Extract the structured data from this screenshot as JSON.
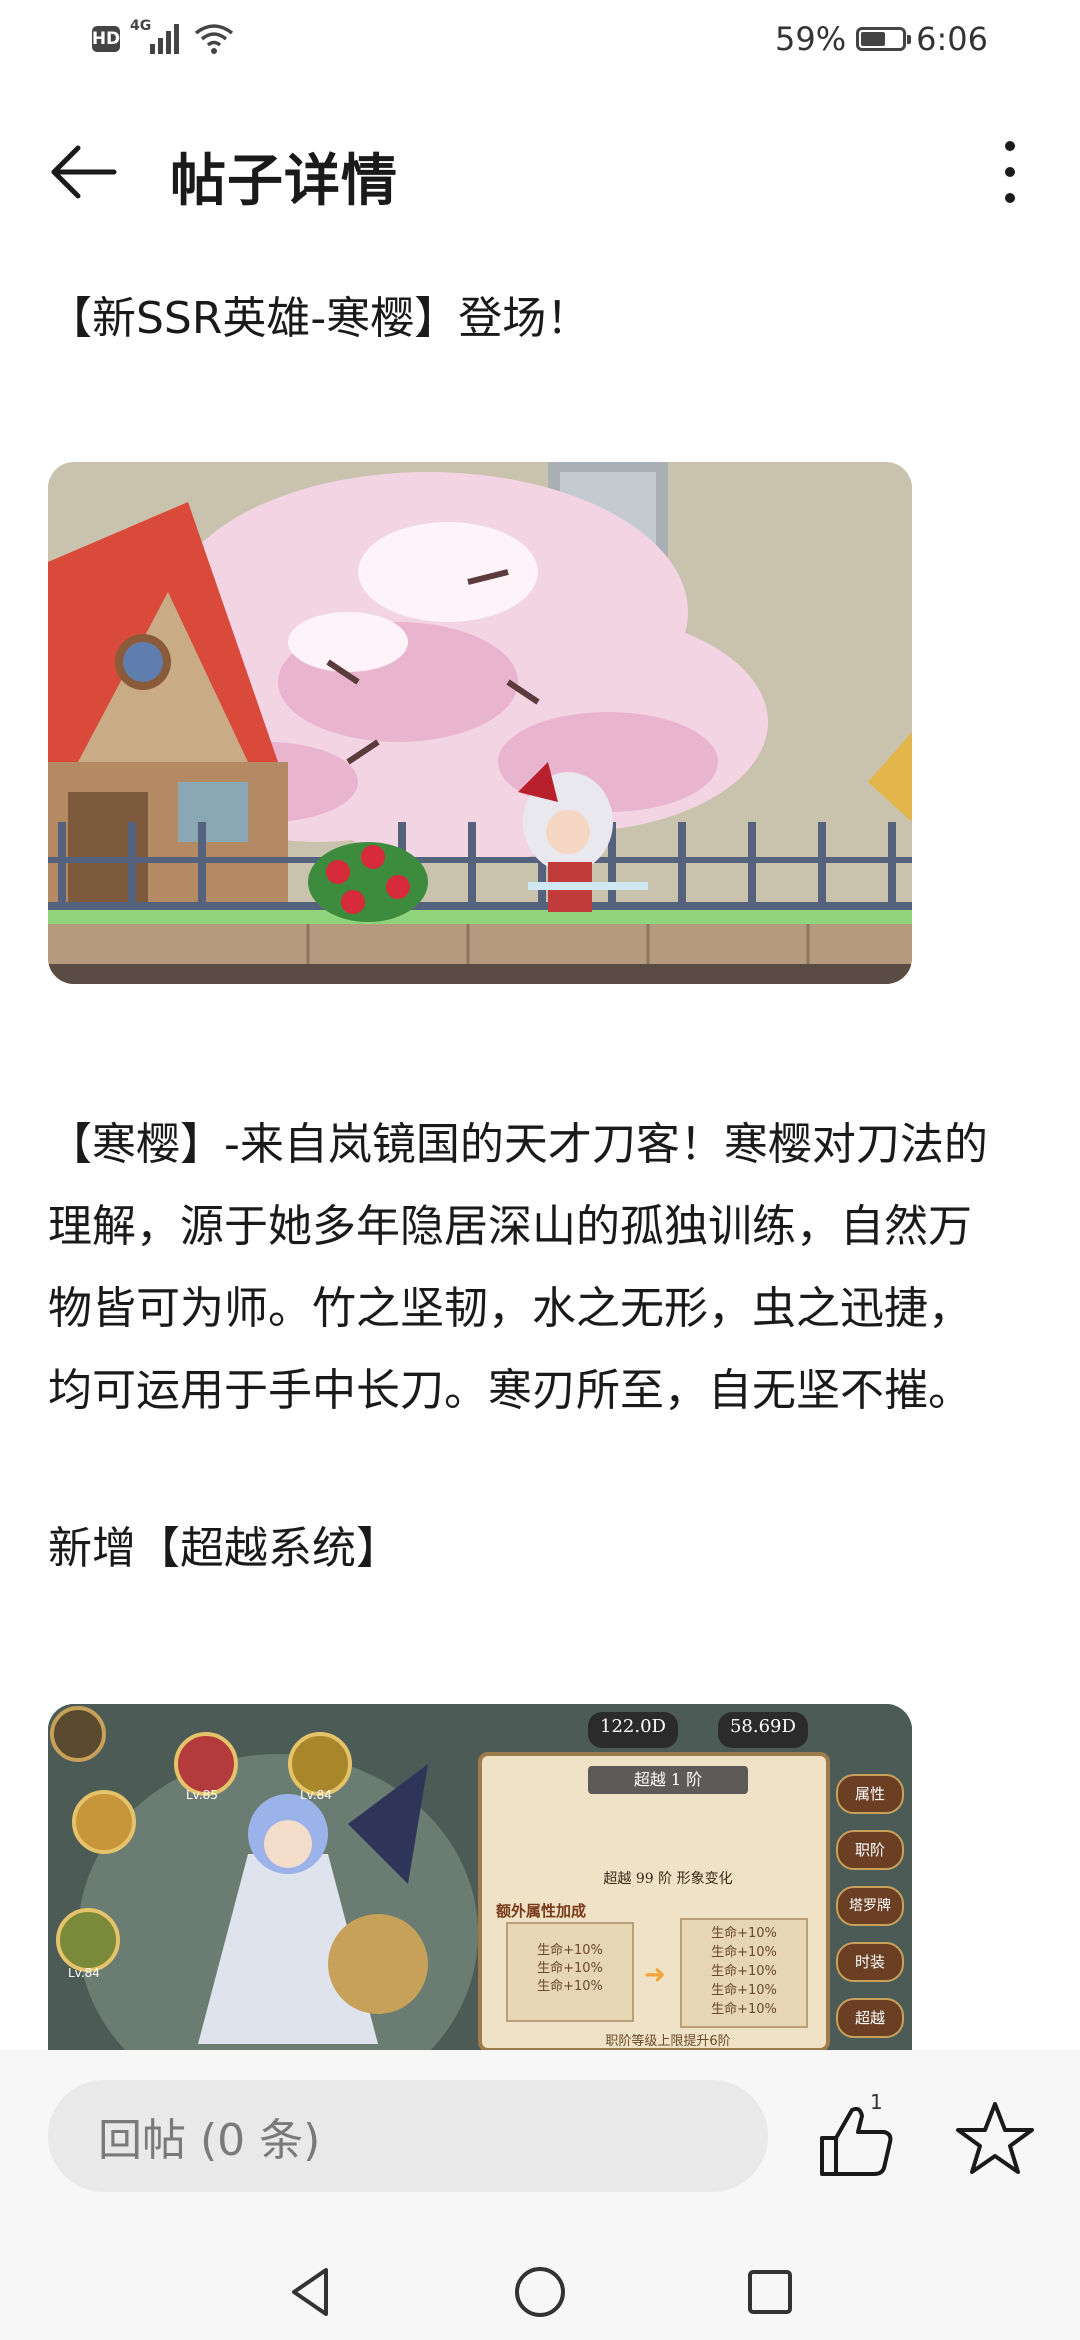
{
  "status_bar": {
    "hd": "HD",
    "network": "4G",
    "battery_percent": "59%",
    "battery_level": 0.59,
    "time": "6:06"
  },
  "app_bar": {
    "title": "帖子详情",
    "back_icon": "arrow-left-icon",
    "more_icon": "more-vertical-icon"
  },
  "post": {
    "headline": "【新SSR英雄-寒樱】登场！",
    "paragraph_lines": [
      "【寒樱】-来自岚镜国的天才刀客！寒樱对刀法的",
      "理解，源于她多年隐居深山的孤独训练，自然万",
      "物皆可为师。竹之坚韧，水之无形，虫之迅捷，",
      "均可运用于手中长刀。寒刃所至，自无坚不摧。"
    ],
    "section_title": "新增【超越系统】",
    "game_ui": {
      "gold": "122.0D",
      "gems": "58.69D",
      "stage_label": "超越 1 阶",
      "stage_note": "超越 99 阶 形象变化",
      "bonus_title": "额外属性加成",
      "left_stats": [
        "生命+10%",
        "生命+10%",
        "生命+10%"
      ],
      "right_stats": [
        "生命+10%",
        "生命+10%",
        "生命+10%",
        "生命+10%",
        "生命+10%"
      ],
      "footer_note": "职阶等级上限提升6阶",
      "side_tabs": [
        "属性",
        "职阶",
        "塔罗牌",
        "时装",
        "超越"
      ],
      "hero_levels": [
        "Lv.85",
        "Lv.84",
        "Lv.84"
      ]
    }
  },
  "bottom_bar": {
    "reply_placeholder": "回帖 (0 条)",
    "like_count": "1",
    "like_icon": "thumbs-up-icon",
    "star_icon": "star-icon"
  },
  "nav_bar": {
    "back_icon": "triangle-back-icon",
    "home_icon": "circle-home-icon",
    "recents_icon": "square-recents-icon"
  }
}
